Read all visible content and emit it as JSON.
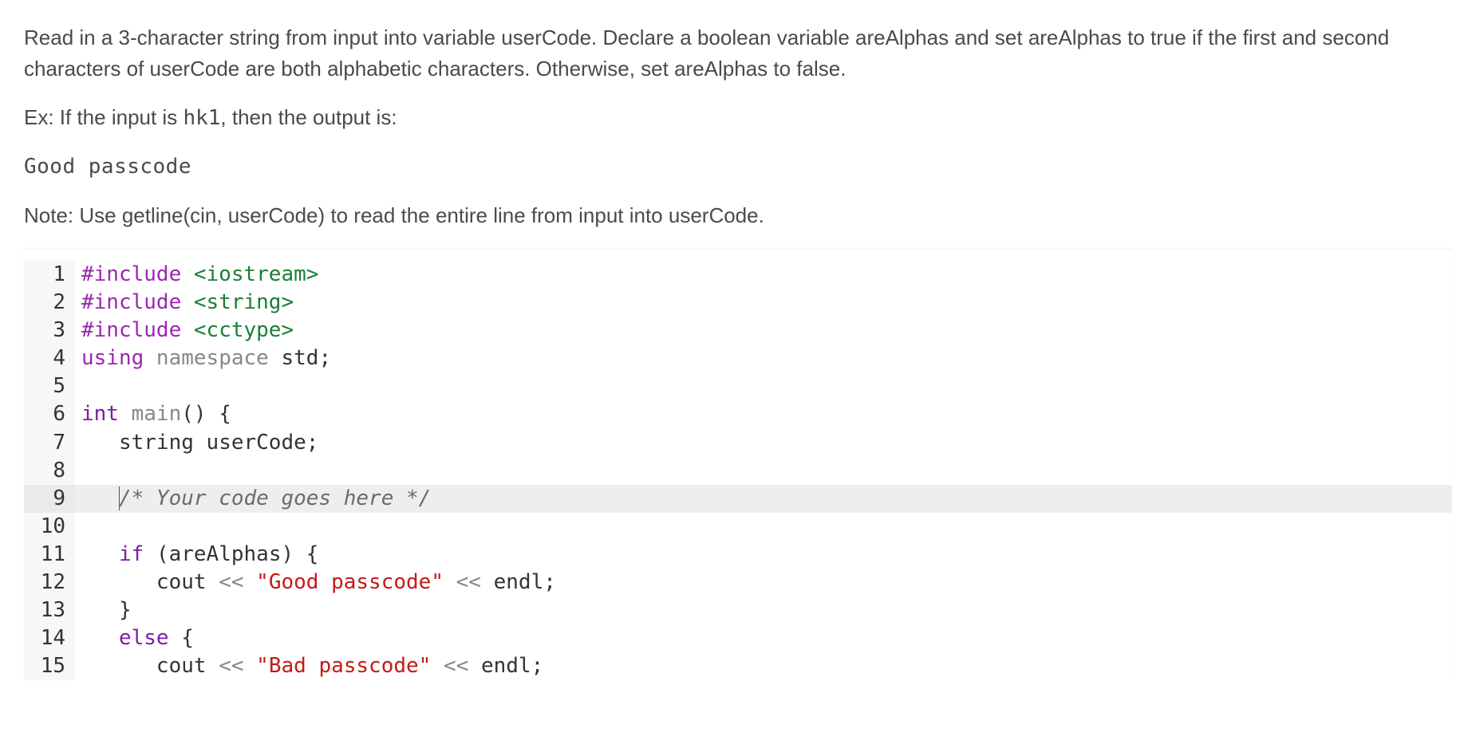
{
  "problem": {
    "description_line1": "Read in a 3-character string from input into variable userCode. Declare a boolean variable areAlphas and set areAlphas to true if the first and second characters of userCode are both alphabetic characters. Otherwise, set areAlphas to false.",
    "example_prefix": "Ex: If the input is ",
    "example_input": "hk1",
    "example_suffix": ", then the output is:",
    "example_output": "Good passcode",
    "note": "Note: Use getline(cin, userCode) to read the entire line from input into userCode."
  },
  "code": {
    "highlighted_line": 9,
    "lines": [
      {
        "n": 1,
        "tokens": [
          {
            "cls": "tok-pp",
            "t": "#include "
          },
          {
            "cls": "tok-inc",
            "t": "<iostream>"
          }
        ]
      },
      {
        "n": 2,
        "tokens": [
          {
            "cls": "tok-pp",
            "t": "#include "
          },
          {
            "cls": "tok-inc",
            "t": "<string>"
          }
        ]
      },
      {
        "n": 3,
        "tokens": [
          {
            "cls": "tok-pp",
            "t": "#include "
          },
          {
            "cls": "tok-inc",
            "t": "<cctype>"
          }
        ]
      },
      {
        "n": 4,
        "tokens": [
          {
            "cls": "tok-pp",
            "t": "using "
          },
          {
            "cls": "tok-grey",
            "t": "namespace "
          },
          {
            "cls": "tok-ident",
            "t": "std"
          },
          {
            "cls": "tok-semi",
            "t": ";"
          }
        ]
      },
      {
        "n": 5,
        "tokens": []
      },
      {
        "n": 6,
        "tokens": [
          {
            "cls": "tok-type",
            "t": "int "
          },
          {
            "cls": "tok-grey",
            "t": "main"
          },
          {
            "cls": "tok-punc",
            "t": "() {"
          }
        ]
      },
      {
        "n": 7,
        "tokens": [
          {
            "cls": "",
            "t": "   "
          },
          {
            "cls": "tok-ident",
            "t": "string userCode;"
          }
        ]
      },
      {
        "n": 8,
        "tokens": []
      },
      {
        "n": 9,
        "tokens": [
          {
            "cls": "",
            "t": "   "
          },
          {
            "cls": "tok-cursor",
            "t": ""
          },
          {
            "cls": "tok-cmt",
            "t": "/* Your code goes here */"
          }
        ]
      },
      {
        "n": 10,
        "tokens": []
      },
      {
        "n": 11,
        "tokens": [
          {
            "cls": "",
            "t": "   "
          },
          {
            "cls": "tok-kw",
            "t": "if "
          },
          {
            "cls": "tok-punc",
            "t": "(areAlphas) {"
          }
        ]
      },
      {
        "n": 12,
        "tokens": [
          {
            "cls": "",
            "t": "      "
          },
          {
            "cls": "tok-ident",
            "t": "cout "
          },
          {
            "cls": "tok-grey",
            "t": "<< "
          },
          {
            "cls": "tok-str",
            "t": "\"Good passcode\""
          },
          {
            "cls": "tok-grey",
            "t": " << "
          },
          {
            "cls": "tok-ident",
            "t": "endl;"
          }
        ]
      },
      {
        "n": 13,
        "tokens": [
          {
            "cls": "",
            "t": "   "
          },
          {
            "cls": "tok-punc",
            "t": "}"
          }
        ]
      },
      {
        "n": 14,
        "tokens": [
          {
            "cls": "",
            "t": "   "
          },
          {
            "cls": "tok-kw",
            "t": "else "
          },
          {
            "cls": "tok-punc",
            "t": "{"
          }
        ]
      },
      {
        "n": 15,
        "tokens": [
          {
            "cls": "",
            "t": "      "
          },
          {
            "cls": "tok-ident",
            "t": "cout "
          },
          {
            "cls": "tok-grey",
            "t": "<< "
          },
          {
            "cls": "tok-str",
            "t": "\"Bad passcode\""
          },
          {
            "cls": "tok-grey",
            "t": " << "
          },
          {
            "cls": "tok-ident",
            "t": "endl;"
          }
        ]
      }
    ]
  }
}
